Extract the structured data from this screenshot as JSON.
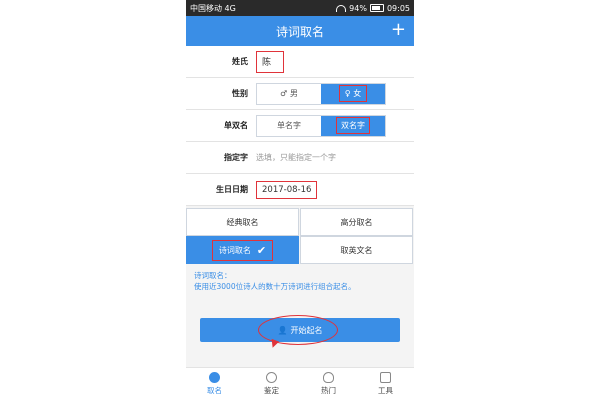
{
  "status": {
    "carrier": "中国移动 4G",
    "battery": "94%",
    "time": "09:05"
  },
  "header": {
    "title": "诗词取名",
    "add_label": "+"
  },
  "form": {
    "surname": {
      "label": "姓氏",
      "value": "陈"
    },
    "gender": {
      "label": "性别",
      "male": "男",
      "female": "女",
      "selected": "女"
    },
    "name_type": {
      "label": "单双名",
      "single": "单名字",
      "double": "双名字",
      "selected": "双名字"
    },
    "specified_char": {
      "label": "指定字",
      "placeholder": "选填，只能指定一个字"
    },
    "birthday": {
      "label": "生日日期",
      "value": "2017-08-16"
    }
  },
  "modes": {
    "classic": "经典取名",
    "high_score": "高分取名",
    "poetry": "诗词取名",
    "english": "取英文名",
    "selected": "诗词取名"
  },
  "description": {
    "title": "诗词取名：",
    "text": "使用近3000位诗人的数十万诗词进行组合起名。"
  },
  "start_button": {
    "label": "开始起名"
  },
  "tabbar": [
    {
      "label": "取名",
      "active": true
    },
    {
      "label": "鉴定",
      "active": false
    },
    {
      "label": "热门",
      "active": false
    },
    {
      "label": "工具",
      "active": false
    }
  ],
  "colors": {
    "accent": "#3a8ee6",
    "annotation": "#e0333a"
  }
}
